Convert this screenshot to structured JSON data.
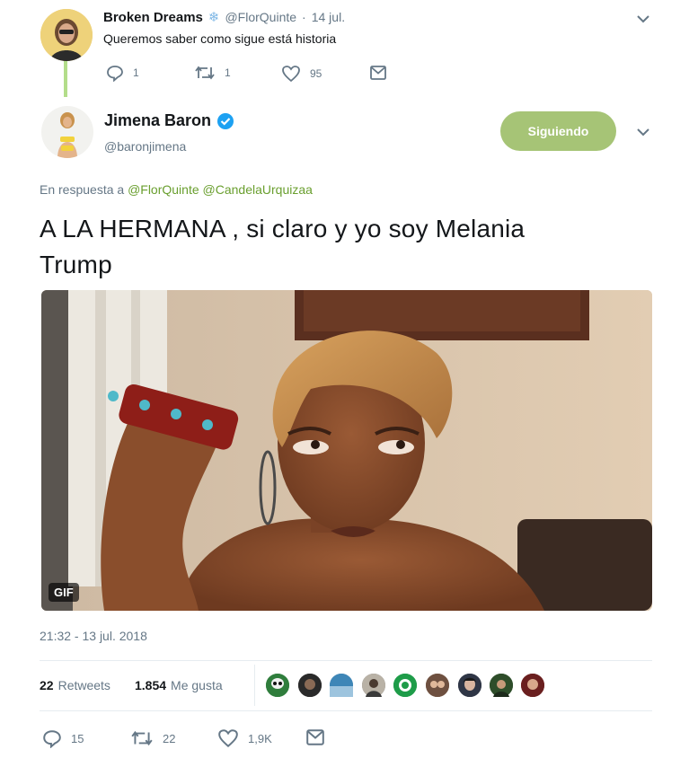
{
  "reply_tweet": {
    "name": "Broken Dreams",
    "name_icon": "snowflake-icon",
    "handle": "@FlorQuinte",
    "separator": "·",
    "date": "14 jul.",
    "text": "Queremos saber como sigue está historia",
    "actions": {
      "replies": "1",
      "retweets": "1",
      "likes": "95"
    }
  },
  "main_tweet": {
    "name": "Jimena Baron",
    "handle": "@baronjimena",
    "follow_label": "Siguiendo",
    "reply_prefix": "En respuesta a",
    "reply_mentions": [
      "@FlorQuinte",
      "@CandelaUrquizaa"
    ],
    "text_line1": "A LA HERMANA , si claro y yo soy Melania",
    "text_line2": "Trump",
    "media_badge": "GIF",
    "timestamp": "21:32 - 13 jul. 2018",
    "retweet_count": "22",
    "retweet_label": "Retweets",
    "like_count": "1.854",
    "like_label": "Me gusta",
    "actions": {
      "replies": "15",
      "retweets": "22",
      "likes": "1,9K"
    }
  },
  "colors": {
    "accent_green": "#a6c476",
    "link_green": "#6a9f2f",
    "thread_line": "#b3dd8a",
    "verified_blue": "#1da1f2",
    "secondary_text": "#657786"
  }
}
